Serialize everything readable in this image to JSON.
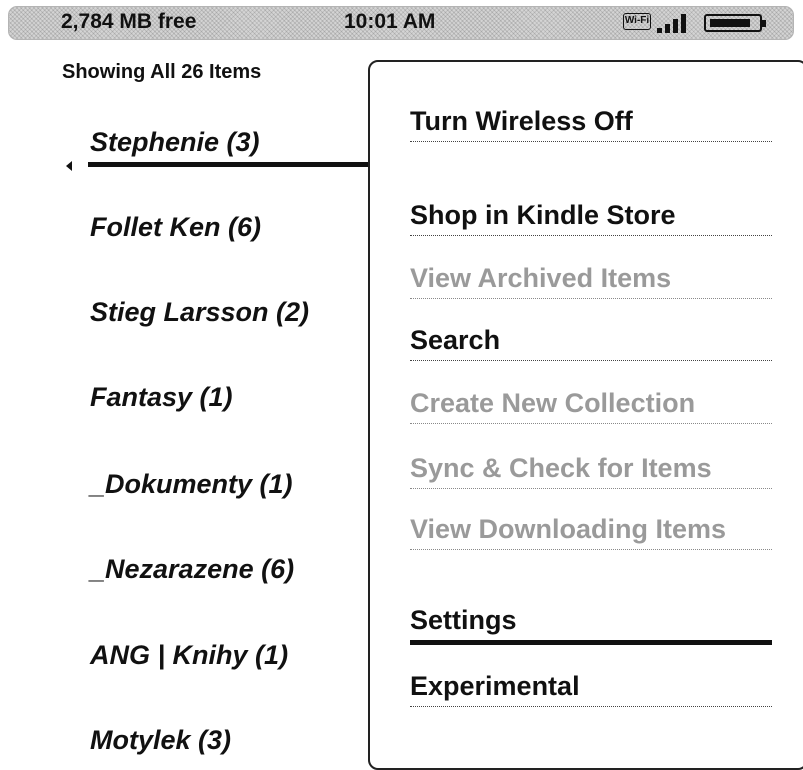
{
  "status_bar": {
    "free_space": "2,784 MB free",
    "time": "10:01 AM",
    "wifi_label": "Wi-Fi",
    "icons": [
      "wifi-icon",
      "signal-strength-icon",
      "battery-icon"
    ]
  },
  "library": {
    "showing_label": "Showing All 26 Items",
    "items": [
      "Stephenie (3)",
      "Follet Ken (6)",
      "Stieg Larsson (2)",
      "Fantasy (1)",
      "_Dokumenty (1)",
      "_Nezarazene (6)",
      "ANG | Knihy (1)",
      "Motylek (3)"
    ],
    "selected_index": 0
  },
  "menu": {
    "items": [
      {
        "label": "Turn Wireless Off",
        "enabled": true
      },
      {
        "label": "Shop in Kindle Store",
        "enabled": true
      },
      {
        "label": "View Archived Items",
        "enabled": false
      },
      {
        "label": "Search",
        "enabled": true
      },
      {
        "label": "Create New Collection",
        "enabled": false
      },
      {
        "label": "Sync & Check for Items",
        "enabled": false
      },
      {
        "label": "View Downloading Items",
        "enabled": false
      },
      {
        "label": "Settings",
        "enabled": true,
        "selected": true
      },
      {
        "label": "Experimental",
        "enabled": true
      }
    ]
  }
}
